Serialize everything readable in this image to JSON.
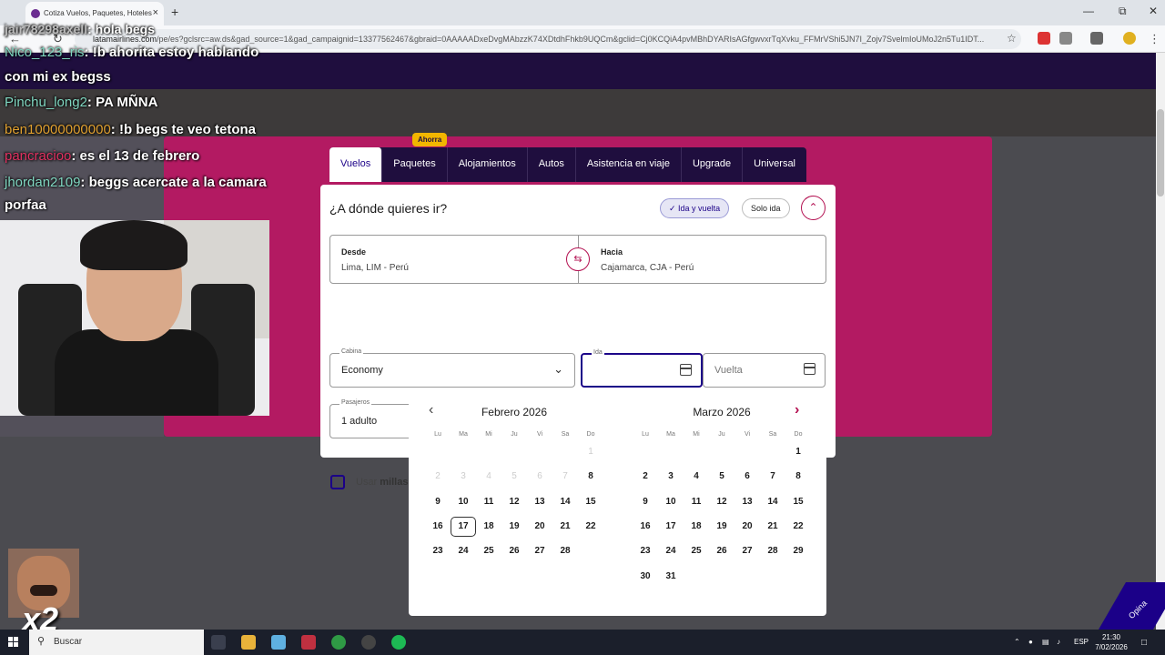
{
  "browser": {
    "tab_title": "Cotiza Vuelos, Paquetes, Hoteles",
    "new_tab": "+",
    "close_tab": "×",
    "url_domain": "latamairlines.com",
    "url_path": "/pe/es?gclsrc=aw.ds&gad_source=1&gad_campaignid=13377562467&gbraid=0AAAAADxeDvgMAbzzK74XDtdhFhkb9UQCm&gclid=Cj0KCQiA4pvMBhDYARIsAGfgwvxrTqXvku_FFMrVShi5JN7I_Zojv7SvelmIoUMoJ2n5Tu1IDT..."
  },
  "product_tabs": {
    "badge": "Ahorra",
    "items": [
      {
        "label": "Vuelos"
      },
      {
        "label": "Paquetes"
      },
      {
        "label": "Alojamientos"
      },
      {
        "label": "Autos"
      },
      {
        "label": "Asistencia en viaje"
      },
      {
        "label": "Upgrade"
      },
      {
        "label": "Universal"
      }
    ]
  },
  "search": {
    "title": "¿A dónde quieres ir?",
    "trip_roundtrip": "Ida y vuelta",
    "trip_oneway": "Solo ida",
    "origin_label": "Desde",
    "origin_value": "Lima, LIM - Perú",
    "dest_label": "Hacia",
    "dest_value": "Cajamarca, CJA - Perú",
    "cabin_label": "Cabina",
    "cabin_value": "Economy",
    "depart_label": "Ida",
    "return_placeholder": "Vuelta",
    "passengers_label": "Pasajeros",
    "passengers_value": "1 adulto",
    "miles_prefix": "Usar ",
    "miles_bold": "millas"
  },
  "datepicker": {
    "dow": [
      "Lu",
      "Ma",
      "Mi",
      "Ju",
      "Vi",
      "Sa",
      "Do"
    ],
    "months": [
      {
        "title": "Febrero 2026",
        "first_weekday": 6,
        "days": 28,
        "disabled_until": 7,
        "hover": 17
      },
      {
        "title": "Marzo 2026",
        "first_weekday": 6,
        "days": 31,
        "disabled_until": 0,
        "hover": 0
      }
    ]
  },
  "overlay": {
    "chat": [
      {
        "user": "Nico_123_ris",
        "color": "#7fd6c0",
        "msg": ": !b ahorita estoy hablando"
      },
      {
        "user": "",
        "color": "#ffffff",
        "msg": "con mi ex begss"
      },
      {
        "user": "Pinchu_long2",
        "color": "#7fd6c0",
        "msg": ": PA MÑNA"
      },
      {
        "user": "ben10000000000",
        "color": "#e0a030",
        "msg": ": !b begs te veo tetona"
      },
      {
        "user": "pancracioo",
        "color": "#e03060",
        "msg": ": es el 13 de febrero"
      },
      {
        "user": "jhordan2109",
        "color": "#7fd6c0",
        "msg": ": beggs acercate a la camara"
      },
      {
        "user": "",
        "color": "#ffffff",
        "msg": "porfaa"
      }
    ],
    "top_user": "jair78298axell",
    "top_msg": ": hola begs",
    "emote_multiplier": "x2",
    "opina": "Opina"
  },
  "taskbar": {
    "search": "Buscar",
    "lang": "ESP",
    "time": "21:30",
    "date": "7/02/2026"
  }
}
